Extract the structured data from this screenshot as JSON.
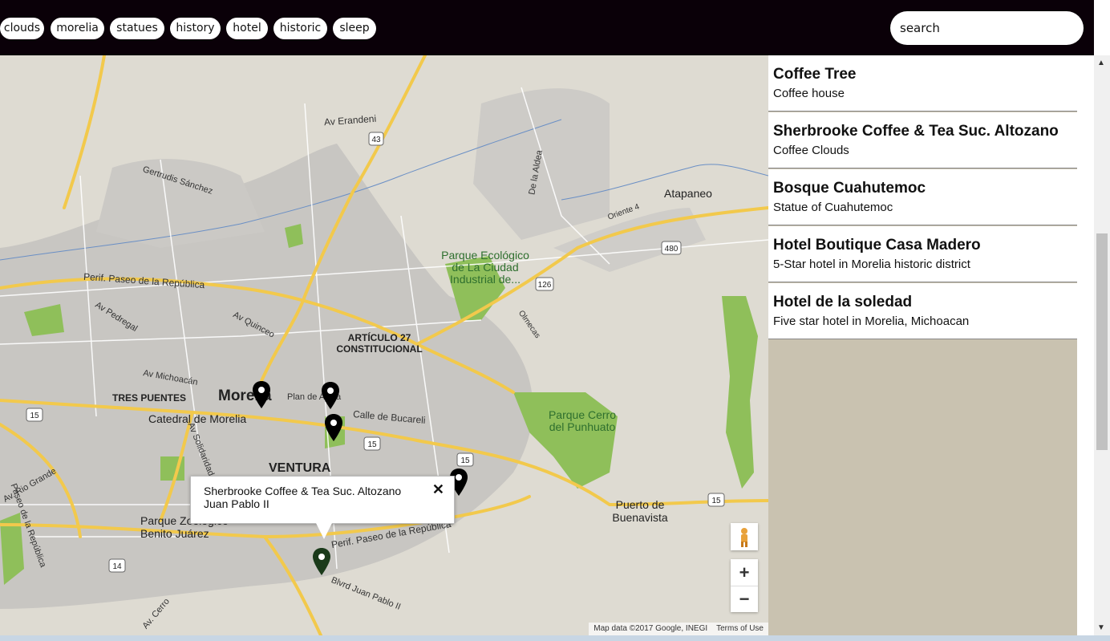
{
  "filters": [
    "clouds",
    "morelia",
    "statues",
    "history",
    "hotel",
    "historic",
    "sleep"
  ],
  "search": {
    "placeholder": "search"
  },
  "map": {
    "roads": [
      "Av Erandeni",
      "Gertrudis Sánchez",
      "De la Aldea",
      "Oriente 4",
      "Perif. Paseo de la República",
      "Av Pedregal",
      "Av Quinceo",
      "Av Michoacán",
      "Calle de Bucareli",
      "Plan de Ayala",
      "Av Solidaridad",
      "Av. Rio Grande",
      "Paseo de la República",
      "Perif. Paseo de la República",
      "Blvrd Juan Pablo II",
      "Av. Cerro",
      "Olmecas"
    ],
    "places": [
      "Atapaneo",
      "ARTÍCULO 27 CONSTITUCIONAL",
      "TRES PUENTES",
      "Catedral de Morelia",
      "Morelia",
      "VENTURA",
      "Puerto de Buenavista",
      "Parque Zoológico Benito Juárez"
    ],
    "parks": [
      "Parque Ecológico de La Ciudad Industrial de...",
      "Parque Cerro del Punhuato"
    ],
    "shields": [
      "43",
      "126",
      "480",
      "15",
      "15",
      "15",
      "14",
      "15"
    ],
    "info_window": {
      "title": "Sherbrooke Coffee & Tea Suc. Altozano",
      "subtitle": "Juan Pablo II",
      "close": "✕"
    },
    "zoom_in": "+",
    "zoom_out": "−",
    "attribution": "Map data ©2017 Google, INEGI",
    "terms": "Terms of Use",
    "pegman_icon": "pegman-icon"
  },
  "locations": [
    {
      "title": "Coffee Tree",
      "subtitle": "Coffee house"
    },
    {
      "title": "Sherbrooke Coffee & Tea Suc. Altozano",
      "subtitle": "Coffee Clouds"
    },
    {
      "title": "Bosque Cuahutemoc",
      "subtitle": "Statue of Cuahutemoc"
    },
    {
      "title": "Hotel Boutique Casa Madero",
      "subtitle": "5-Star hotel in Morelia historic district"
    },
    {
      "title": "Hotel de la soledad",
      "subtitle": "Five star hotel in Morelia, Michoacan"
    }
  ],
  "colors": {
    "topbar": "#0a0008",
    "map_bg": "#dedbd2",
    "road_major": "#f2c94c",
    "park": "#8fbf5a",
    "panel_bg": "#c9c2b0"
  }
}
